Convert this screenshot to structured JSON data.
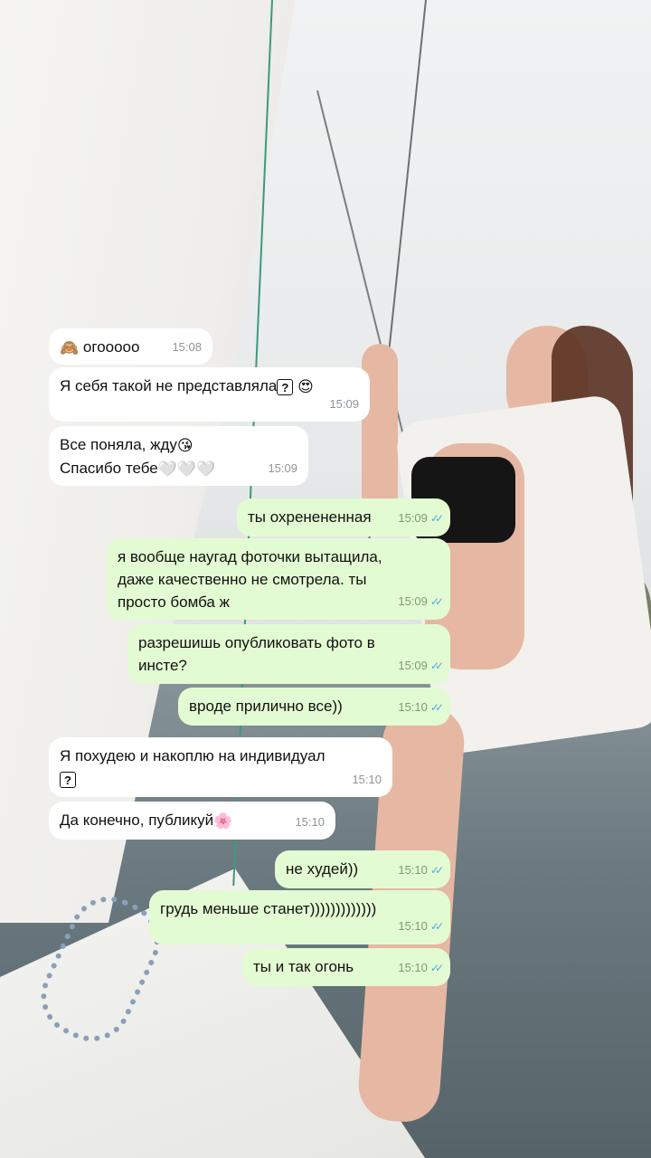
{
  "messages": [
    {
      "side": "in",
      "text": "огооооо",
      "time": "15:08",
      "emoji": "see-no-evil-monkey"
    },
    {
      "side": "in",
      "text": "Я себя такой не представляла",
      "time": "15:09",
      "emoji": "heart-eyes",
      "marker": "?"
    },
    {
      "side": "in",
      "text": "Все поняла, жду",
      "time": "",
      "emoji": "kissing-face"
    },
    {
      "side": "in",
      "text": "Спасибо тебе",
      "time": "15:09",
      "emoji": "white-hearts"
    },
    {
      "side": "out",
      "text": "ты охренененная",
      "time": "15:09"
    },
    {
      "side": "out",
      "text": "я вообще наугад фоточки вытащила,\nдаже качественно не смотрела. ты\nпросто бомба ж",
      "time": "15:09"
    },
    {
      "side": "out",
      "text": "разрешишь опубликовать фото в\nинсте?",
      "time": "15:09"
    },
    {
      "side": "out",
      "text": "вроде прилично все))",
      "time": "15:10"
    },
    {
      "side": "in",
      "text": "Я похудею и накоплю на индивидуал",
      "time": "15:10",
      "marker": "?"
    },
    {
      "side": "in",
      "text": "Да конечно, публикуй",
      "time": "15:10",
      "emoji": "cherry-blossom"
    },
    {
      "side": "out",
      "text": "не худей))",
      "time": "15:10"
    },
    {
      "side": "out",
      "text": "грудь меньше станет)))))))))))))",
      "time": "15:10"
    },
    {
      "side": "out",
      "text": "ты и так огонь",
      "time": "15:10"
    }
  ],
  "colors": {
    "incoming": "#ffffff",
    "outgoing": "#e3fbd2",
    "underline": "#e0303c",
    "read_ticks": "#4fa7e0"
  }
}
